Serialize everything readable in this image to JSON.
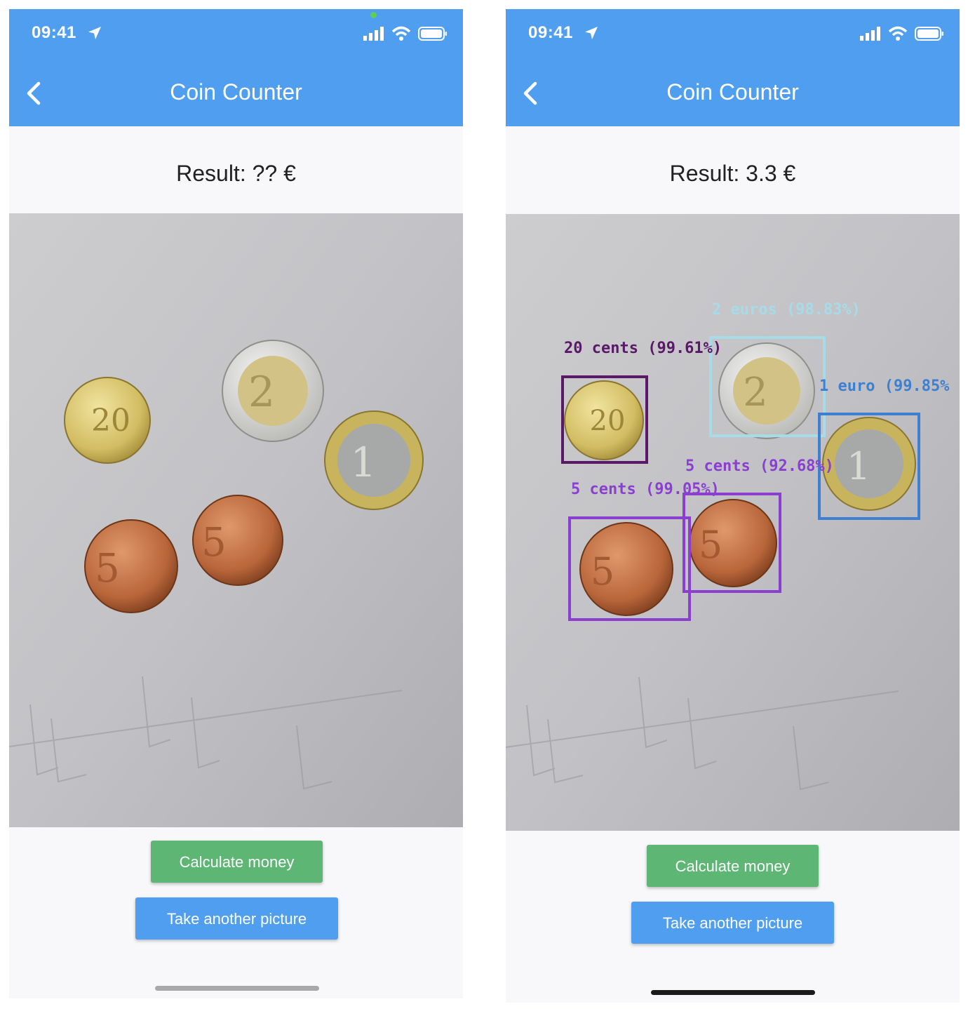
{
  "screens": [
    {
      "status_time": "09:41",
      "title": "Coin Counter",
      "result_text": "Result: ?? €",
      "buttons": {
        "calculate": "Calculate money",
        "take_picture": "Take another picture"
      }
    },
    {
      "status_time": "09:41",
      "title": "Coin Counter",
      "result_text": "Result: 3.3 €",
      "buttons": {
        "calculate": "Calculate money",
        "take_picture": "Take another picture"
      },
      "detections": [
        {
          "label": "2 euros (98.83%)",
          "color": "#a7dbe8"
        },
        {
          "label": "20 cents (99.61%)",
          "color": "#5a1868"
        },
        {
          "label": "1 euro (99.85%",
          "color": "#3f7fd0"
        },
        {
          "label": "5 cents (92.68%)",
          "color": "#8a3fd0"
        },
        {
          "label": "5 cents (99.05%)",
          "color": "#8a3fd0"
        }
      ]
    }
  ],
  "colors": {
    "appbar": "#4f9ef0",
    "calculate_button": "#5db673",
    "take_picture_button": "#4f9ef0"
  },
  "icons": [
    "location-arrow-icon",
    "signal-icon",
    "wifi-icon",
    "battery-icon",
    "back-chevron-icon"
  ]
}
